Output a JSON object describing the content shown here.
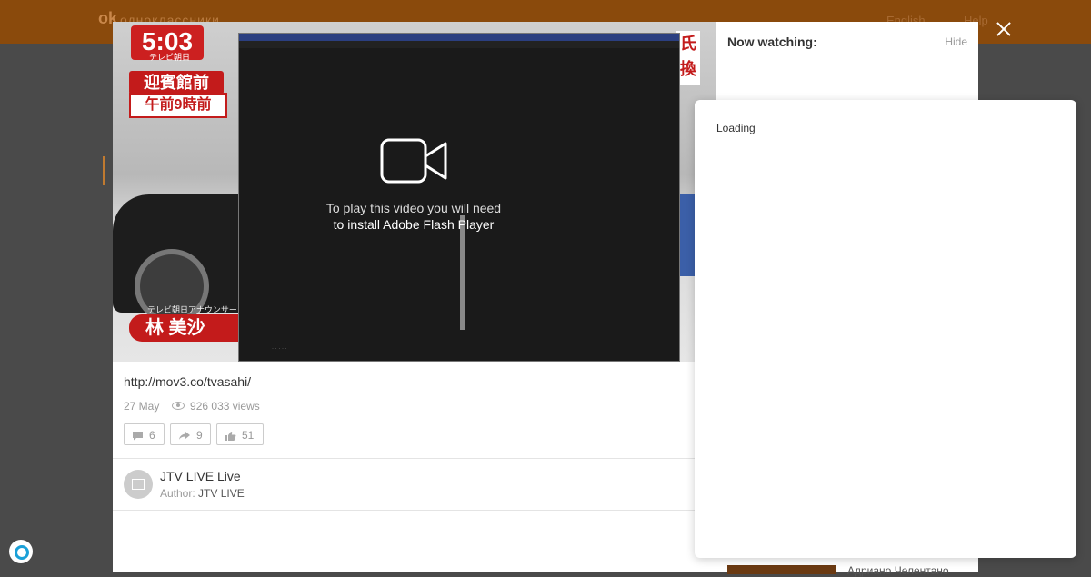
{
  "header": {
    "logo_text": "одноклассники",
    "language": "English",
    "help": "Help"
  },
  "player": {
    "tv_overlay": {
      "time": "5:03",
      "channel": "テレビ朝日",
      "location": "迎賓館前",
      "hour": "午前9時前",
      "name": "林 美沙",
      "name_sub": "テレビ朝日アナウンサー",
      "right_label": "氏 換"
    },
    "flash": {
      "message_line1": "To play this video you will need",
      "message_line2": "to install Adobe Flash Player"
    },
    "url": "http://mov3.co/tvasahi/",
    "date": "27 May",
    "views": "926 033 views",
    "comments_count": "6",
    "shares_count": "9",
    "likes_count": "51",
    "channel_title": "JTV LIVE Live",
    "author_label": "Author:",
    "author_name": "JTV LIVE"
  },
  "sidebar": {
    "title": "Now watching:",
    "hide_label": "Hide",
    "related_title": "Адриано Челентано"
  },
  "loading_panel": {
    "text": "Loading"
  },
  "colors": {
    "header_bg": "#8a4a0c",
    "overlay_bg": "#4a4a4a"
  }
}
